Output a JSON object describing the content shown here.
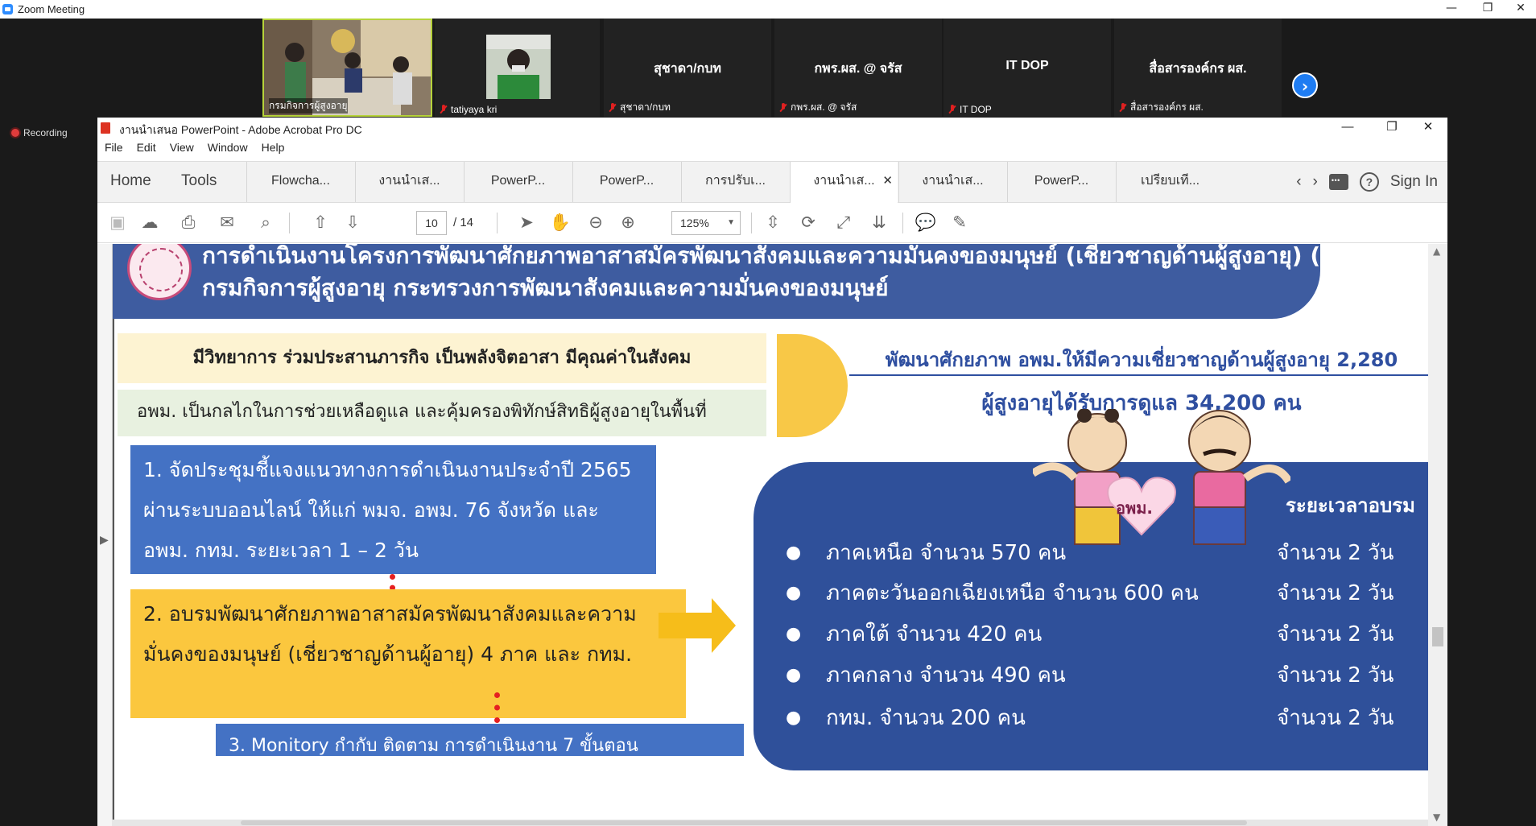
{
  "zoom": {
    "window_title": "Zoom Meeting",
    "recording_label": "Recording",
    "participants": [
      {
        "name": "กรมกิจการผู้สูงอายุ",
        "label": "กรมกิจการผู้สูงอายุ"
      },
      {
        "name": "tatiyaya kri",
        "label": "tatiyaya kri"
      },
      {
        "name": "สุชาดา/กบท",
        "label": "สุชาดา/กบท"
      },
      {
        "name": "กพร.ผส. @ จรัส",
        "label": "กพร.ผส. @ จรัส"
      },
      {
        "name": "IT DOP",
        "label": "IT DOP"
      },
      {
        "name": "สื่อสารองค์กร ผส.",
        "label": "สื่อสารองค์กร ผส."
      }
    ],
    "next_icon": "chevron-right-icon"
  },
  "acrobat": {
    "window_title": "งานนำเสนอ PowerPoint - Adobe Acrobat Pro DC",
    "menu": [
      "File",
      "Edit",
      "View",
      "Window",
      "Help"
    ],
    "nav": {
      "home": "Home",
      "tools": "Tools"
    },
    "tabs": [
      "Flowcha...",
      "งานนำเส...",
      "PowerP...",
      "PowerP...",
      "การปรับเ...",
      "งานนำเส...",
      "งานนำเส...",
      "PowerP...",
      "เปรียบเที..."
    ],
    "active_tab_index": 5,
    "sign_in": "Sign In",
    "page_current": "10",
    "page_total": "/ 14",
    "zoom_level": "125%"
  },
  "slide": {
    "banner_line1": "การดำเนินงานโครงการพัฒนาศักยภาพอาสาสมัครพัฒนาสังคมและความมั่นคงของมนุษย์ (เชี่ยวชาญด้านผู้สูงอายุ) (แบบ...",
    "banner_line2": "กรมกิจการผู้สูงอายุ  กระทรวงการพัฒนาสังคมและความมั่นคงของมนุษย์",
    "motto": "มีวิทยาการ  ร่วมประสานภารกิจ  เป็นพลังจิตอาสา  มีคุณค่าในสังคม",
    "mission": "อพม. เป็นกลไกในการช่วยเหลือดูแล และคุ้มครองพิทักษ์สิทธิผู้สูงอายุในพื้นที่",
    "target_line1": "พัฒนาศักยภาพ อพม.ให้มีความเชี่ยวชาญด้านผู้สูงอายุ 2,280",
    "target_line2": "ผู้สูงอายุได้รับการดูแล 34,200 คน",
    "step1": "1. จัดประชุมชี้แจงแนวทางการดำเนินงานประจำปี 2565 ผ่านระบบออนไลน์ ให้แก่ พมจ. อพม. 76 จังหวัด และ อพม. กทม. ระยะเวลา 1 – 2 วัน",
    "step2": "2. อบรมพัฒนาศักยภาพอาสาสมัครพัฒนาสังคมและความมั่นคงของมนุษย์ (เชี่ยวชาญด้านผู้อายุ) 4 ภาค และ กทม.",
    "step3": "3. Monitory กำกับ ติดตาม การดำเนินงาน 7 ขั้นตอน",
    "heart_label": "อพม.",
    "duration_header": "ระยะเวลาอบรม",
    "regions": [
      {
        "region": "ภาคเหนือ จำนวน 570 คน",
        "duration": "จำนวน 2 วัน"
      },
      {
        "region": "ภาคตะวันออกเฉียงเหนือ จำนวน 600 คน",
        "duration": "จำนวน 2 วัน"
      },
      {
        "region": "ภาคใต้ จำนวน 420 คน",
        "duration": "จำนวน 2 วัน"
      },
      {
        "region": "ภาคกลาง จำนวน 490 คน",
        "duration": "จำนวน 2 วัน"
      },
      {
        "region": "กทม. จำนวน 200 คน",
        "duration": "จำนวน 2 วัน"
      }
    ]
  },
  "colors": {
    "accent": "#2d8cff",
    "slide_blue": "#2f509a",
    "slide_yellow": "#fbc73e",
    "recording": "#e03c3c"
  }
}
